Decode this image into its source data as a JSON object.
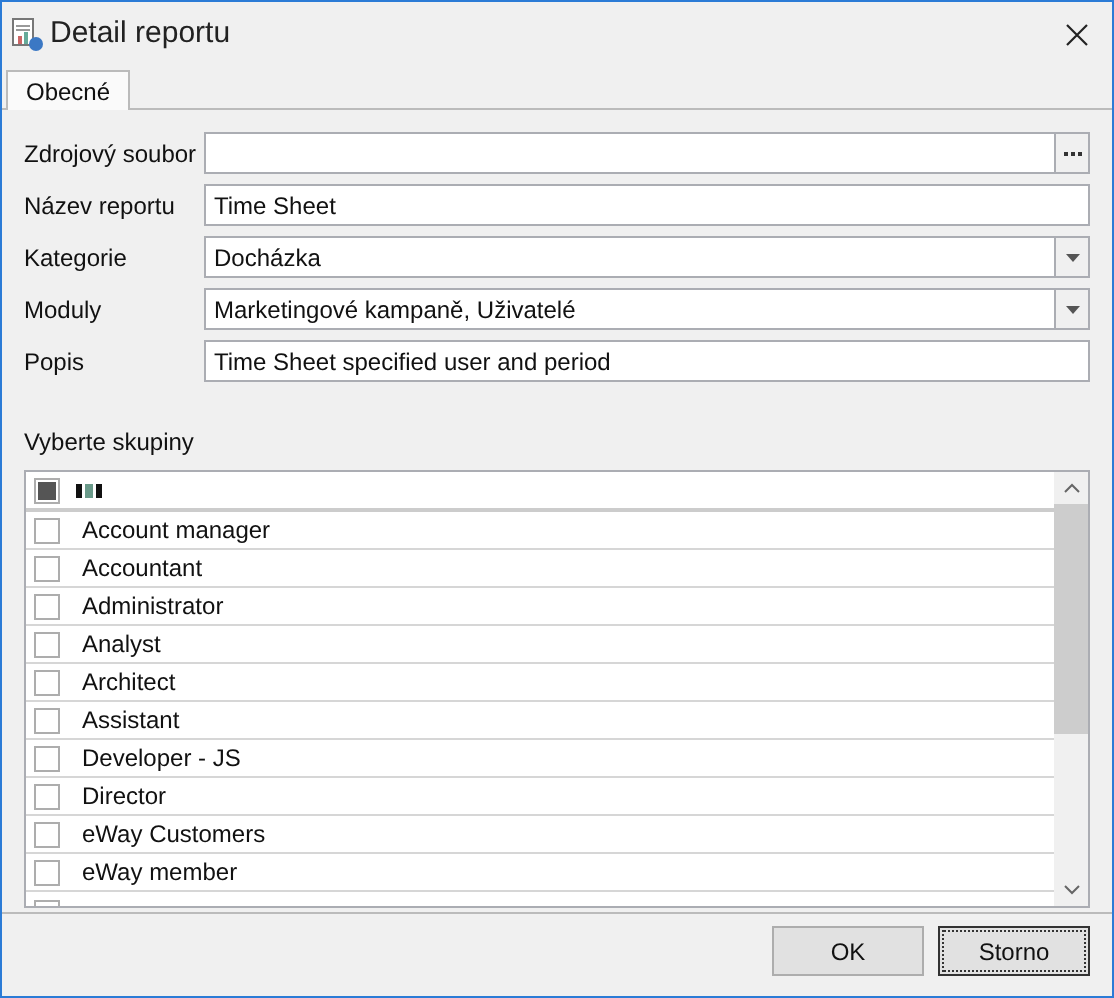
{
  "window": {
    "title": "Detail reportu"
  },
  "tabs": [
    {
      "label": "Obecné",
      "selected": true
    }
  ],
  "form": [
    {
      "label": "Zdrojový soubor",
      "kind": "browse"
    },
    {
      "label": "Název reportu",
      "kind": "text",
      "value": "Time Sheet"
    },
    {
      "label": "Kategorie",
      "kind": "dropdown",
      "value": "Docházka"
    },
    {
      "label": "Moduly",
      "kind": "dropdown",
      "value": "Marketingové kampaně, Uživatelé"
    },
    {
      "label": "Popis",
      "kind": "text",
      "value": "Time Sheet specified user and period"
    }
  ],
  "groups": {
    "label": "Vyberte skupiny",
    "header_checkbox": {
      "partial": true
    },
    "items": [
      {
        "label": "Account manager",
        "checked": false
      },
      {
        "label": "Accountant",
        "checked": false
      },
      {
        "label": "Administrator",
        "checked": false
      },
      {
        "label": "Analyst",
        "checked": false
      },
      {
        "label": "Architect",
        "checked": false
      },
      {
        "label": "Assistant",
        "checked": false
      },
      {
        "label": "Developer - JS",
        "checked": false
      },
      {
        "label": "Director",
        "checked": false
      },
      {
        "label": "eWay Customers",
        "checked": false
      },
      {
        "label": "eWay member",
        "checked": false
      }
    ]
  },
  "buttons": [
    {
      "label": "OK",
      "focused": false
    },
    {
      "label": "Storno",
      "focused": true
    }
  ]
}
